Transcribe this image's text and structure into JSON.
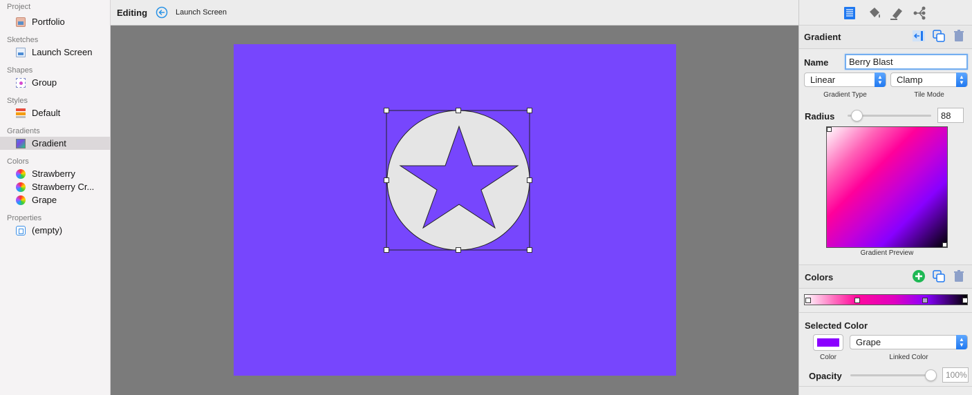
{
  "sidebar": {
    "sections": [
      {
        "heading": "Project",
        "items": [
          {
            "label": "Portfolio",
            "icon": "portfolio-icon"
          }
        ]
      },
      {
        "heading": "Sketches",
        "items": [
          {
            "label": "Launch Screen",
            "icon": "sketch-icon"
          }
        ]
      },
      {
        "heading": "Shapes",
        "items": [
          {
            "label": "Group",
            "icon": "group-icon"
          }
        ]
      },
      {
        "heading": "Styles",
        "items": [
          {
            "label": "Default",
            "icon": "style-icon"
          }
        ]
      },
      {
        "heading": "Gradients",
        "items": [
          {
            "label": "Gradient",
            "icon": "gradient-icon",
            "selected": true
          }
        ]
      },
      {
        "heading": "Colors",
        "items": [
          {
            "label": "Strawberry",
            "icon": "color-wheel-icon"
          },
          {
            "label": "Strawberry Cr...",
            "icon": "color-wheel-icon"
          },
          {
            "label": "Grape",
            "icon": "color-wheel-icon"
          }
        ]
      },
      {
        "heading": "Properties",
        "items": [
          {
            "label": "(empty)",
            "icon": "properties-icon"
          }
        ]
      }
    ]
  },
  "toolbar": {
    "editing_label": "Editing",
    "current_title": "Launch Screen"
  },
  "canvas": {
    "artboard_color": "#7746fd",
    "shape_fill": "#e5e5e5",
    "star_color": "#7746fd"
  },
  "inspector": {
    "tabs": [
      "list-icon",
      "paint-bucket-icon",
      "highlighter-icon",
      "graph-icon"
    ],
    "gradient_title": "Gradient",
    "name_label": "Name",
    "name_value": "Berry Blast",
    "gradient_type_value": "Linear",
    "gradient_type_caption": "Gradient Type",
    "tile_mode_value": "Clamp",
    "tile_mode_caption": "Tile Mode",
    "radius_label": "Radius",
    "radius_value": "88",
    "preview_caption": "Gradient Preview",
    "colors_title": "Colors",
    "selected_color_title": "Selected Color",
    "selected_color_swatch": "#8a00ff",
    "color_caption": "Color",
    "linked_color_value": "Grape",
    "linked_color_caption": "Linked Color",
    "opacity_label": "Opacity",
    "opacity_value": "100%",
    "accent_color": "#1f78f0",
    "add_color": "#1eb854"
  }
}
